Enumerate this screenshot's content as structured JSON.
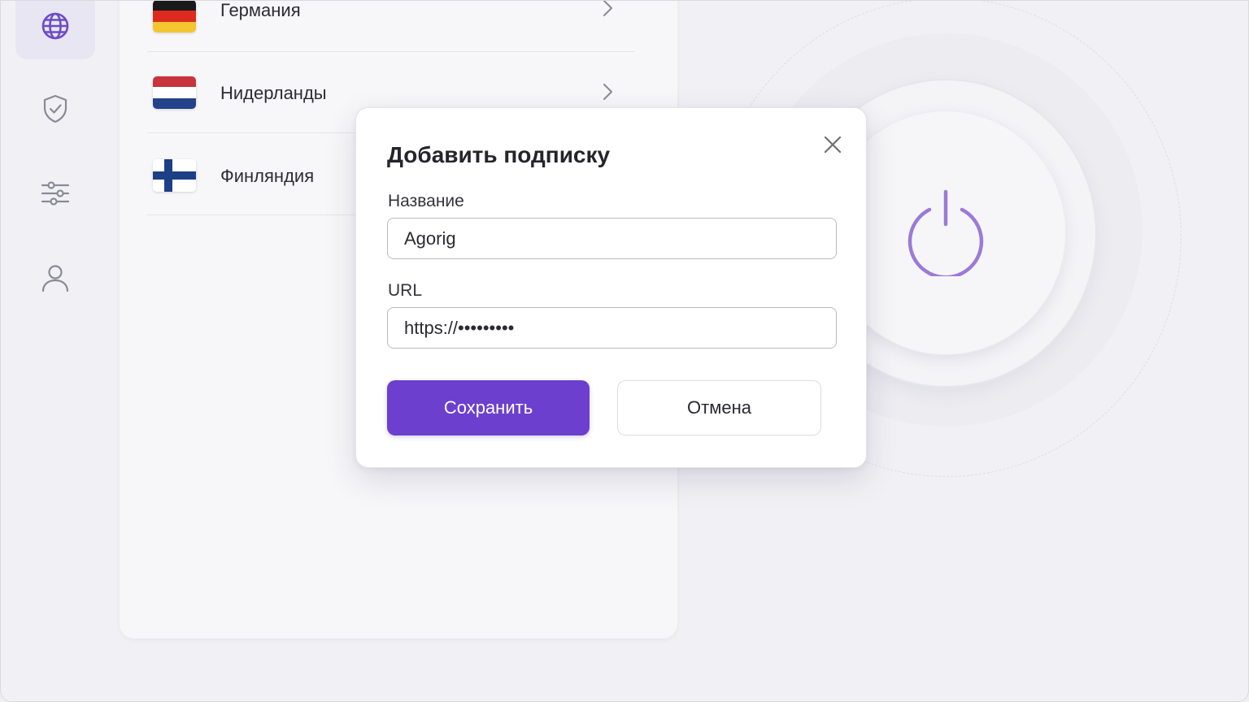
{
  "sidebar": {
    "items": [
      {
        "icon": "globe-icon",
        "active": true
      },
      {
        "icon": "shield-check-icon",
        "active": false
      },
      {
        "icon": "sliders-icon",
        "active": false
      },
      {
        "icon": "user-icon",
        "active": false
      }
    ]
  },
  "servers": [
    {
      "name": "Германия",
      "flag": [
        "#000000",
        "#dd2a1f",
        "#f4c431"
      ]
    },
    {
      "name": "Нидерланды",
      "flag": [
        "#c8343c",
        "#ffffff",
        "#24418c"
      ]
    },
    {
      "name": "Финляндия",
      "flag": "finland"
    }
  ],
  "power": {
    "accent": "#9b7ad8"
  },
  "modal": {
    "title": "Добавить подписку",
    "name_label": "Название",
    "name_value": "Agorig",
    "url_label": "URL",
    "url_value": "https://•••••••••",
    "save_label": "Сохранить",
    "cancel_label": "Отмена"
  },
  "colors": {
    "accent": "#6c3fcf",
    "icon": "#8a8a96",
    "active_icon": "#6c4cc4"
  }
}
